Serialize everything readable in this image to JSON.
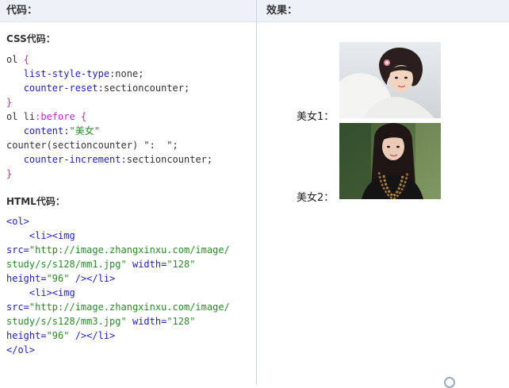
{
  "headers": {
    "code": "代码：",
    "effect": "效果："
  },
  "css": {
    "title": "CSS代码：",
    "lines": [
      {
        "sel": "ol",
        "brace": "{"
      },
      {
        "prop": "list-style-type",
        "val": "none;"
      },
      {
        "prop": "counter-reset",
        "val": "sectioncounter;"
      },
      {
        "brace": "}"
      },
      {
        "sel": "ol li",
        "pseudo": ":before",
        "brace": "{"
      },
      {
        "prop": "content",
        "str": "\"美女\""
      },
      {
        "plain": "counter(sectioncounter) \":  \";"
      },
      {
        "prop": "counter-increment",
        "val": "sectioncounter;"
      },
      {
        "brace": "}"
      }
    ]
  },
  "html": {
    "title": "HTML代码：",
    "ol_open": "<ol>",
    "li_open": "<li><img",
    "src_attr": "src=",
    "src1": "\"http://image.zhangxinxu.com/image/",
    "src1b": "study/s/s128/mm1.jpg\"",
    "src2": "\"http://image.zhangxinxu.com/image/",
    "src2b": "study/s/s128/mm3.jpg\"",
    "width_attr": "width=",
    "width_val": "\"128\"",
    "height_attr": "height=",
    "height_val": "\"96\"",
    "li_close": " /></li>",
    "ol_close": "</ol>"
  },
  "demo": {
    "items": [
      {
        "label": "美女1：",
        "photo": "woman-photo-1"
      },
      {
        "label": "美女2：",
        "photo": "woman-photo-2"
      }
    ]
  }
}
